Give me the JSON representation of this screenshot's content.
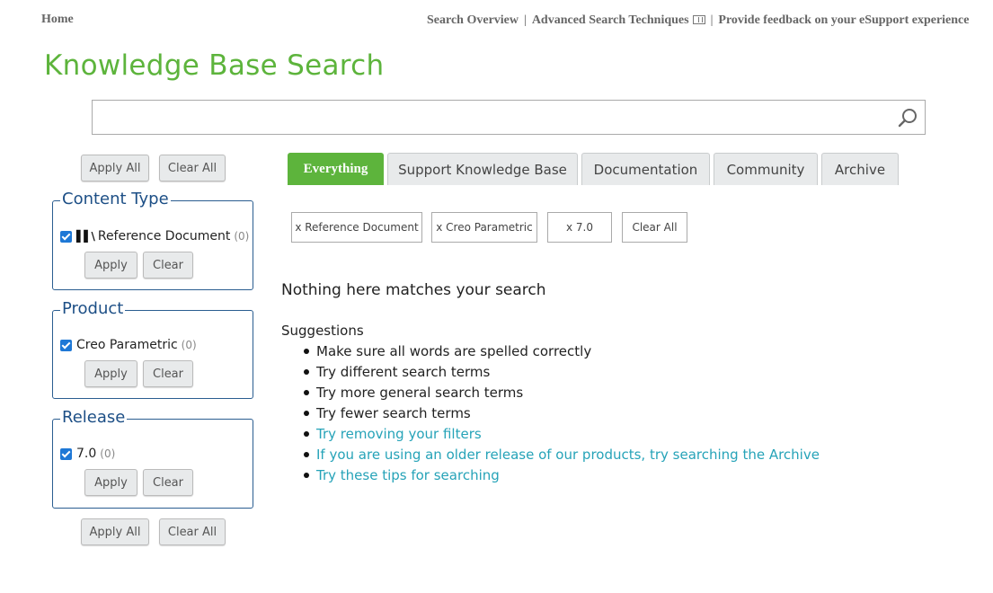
{
  "top_nav": {
    "home": "Home",
    "search_overview": "Search Overview",
    "advanced": "Advanced Search Techniques",
    "feedback": "Provide feedback on your eSupport experience",
    "separator": "|"
  },
  "page_title": "Knowledge Base Search",
  "search": {
    "value": "",
    "placeholder": ""
  },
  "sidebar": {
    "apply_all": "Apply All",
    "clear_all": "Clear All",
    "panels": [
      {
        "legend": "Content Type",
        "facet": "Reference Document",
        "count": "(0)",
        "checked": true,
        "apply": "Apply",
        "clear": "Clear"
      },
      {
        "legend": "Product",
        "facet": "Creo Parametric",
        "count": "(0)",
        "checked": true,
        "apply": "Apply",
        "clear": "Clear"
      },
      {
        "legend": "Release",
        "facet": "7.0",
        "count": "(0)",
        "checked": true,
        "apply": "Apply",
        "clear": "Clear"
      }
    ]
  },
  "tabs": [
    {
      "label": "Everything",
      "active": true
    },
    {
      "label": "Support Knowledge Base",
      "active": false
    },
    {
      "label": "Documentation",
      "active": false
    },
    {
      "label": "Community",
      "active": false
    },
    {
      "label": "Archive",
      "active": false
    }
  ],
  "chips": [
    "x Reference Document",
    "x Creo Parametric",
    "x 7.0",
    "Clear All"
  ],
  "results": {
    "message": "Nothing here matches your search",
    "suggestions_title": "Suggestions",
    "suggestions": [
      {
        "text": "Make sure all words are spelled correctly",
        "link": false
      },
      {
        "text": "Try different search terms",
        "link": false
      },
      {
        "text": "Try more general search terms",
        "link": false
      },
      {
        "text": "Try fewer search terms",
        "link": false
      },
      {
        "text": "Try removing your filters",
        "link": true
      },
      {
        "text": "If you are using an older release of our products, try searching the Archive",
        "link": true
      },
      {
        "text": "Try these tips for searching",
        "link": true
      }
    ]
  },
  "colors": {
    "brand_green": "#5db43c",
    "legend_blue": "#1d4f86",
    "link_teal": "#26a3b8",
    "checkbox_blue": "#1e78d6"
  }
}
